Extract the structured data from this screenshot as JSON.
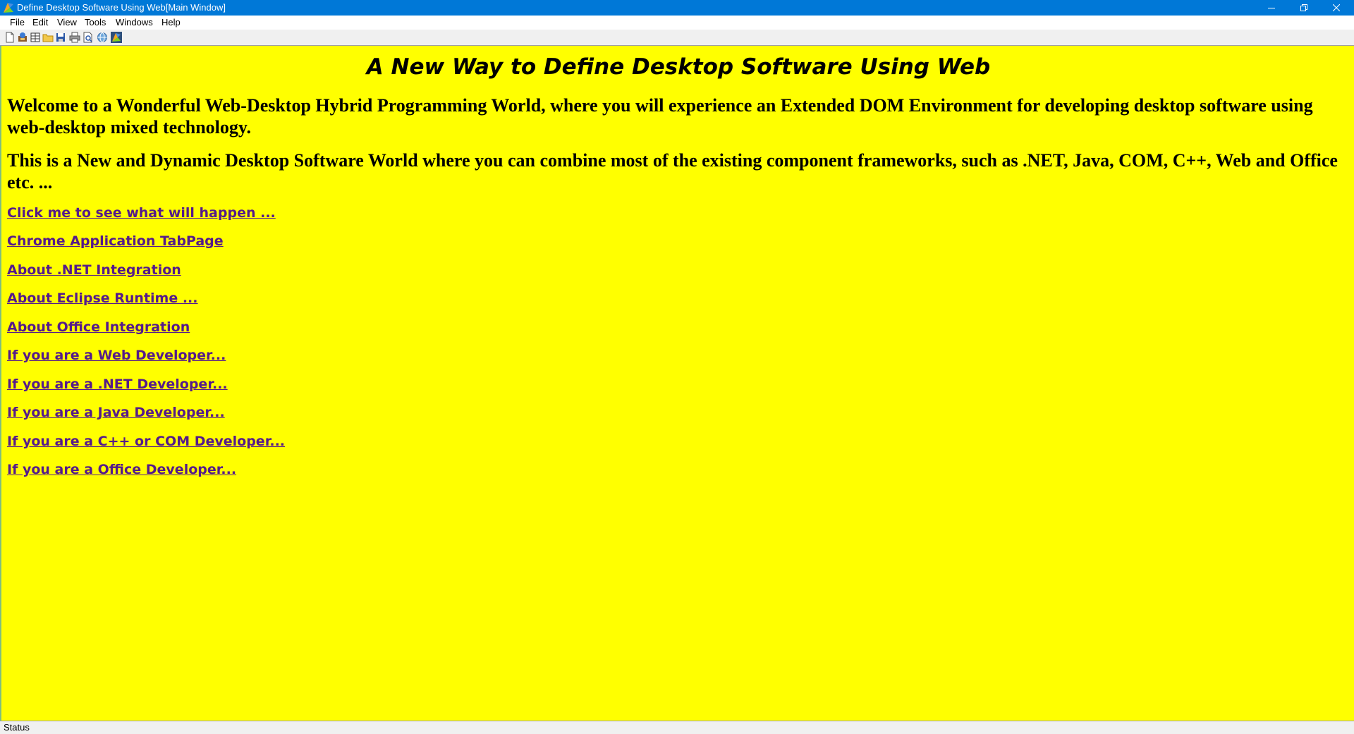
{
  "window": {
    "title": "Define Desktop Software Using Web[Main Window]",
    "app_icon": "app-logo-icon"
  },
  "menubar": {
    "items": [
      "File",
      "Edit",
      "View",
      "Tools",
      "Windows",
      "Help"
    ]
  },
  "toolbar": {
    "buttons": [
      "new-document-icon",
      "web-app-icon",
      "table-icon",
      "open-folder-icon",
      "save-icon",
      "print-icon",
      "print-preview-icon",
      "globe-icon",
      "app-logo-icon"
    ]
  },
  "content": {
    "heading": "A New Way to Define Desktop Software Using Web",
    "paragraphs": [
      "Welcome to a Wonderful Web-Desktop Hybrid Programming World, where you will experience an Extended DOM Environment for developing desktop software using web-desktop mixed technology.",
      "This is a New and Dynamic Desktop Software World where you can combine most of the existing component frameworks, such as .NET, Java, COM, C++, Web and Office etc. ..."
    ],
    "links": [
      "Click me to see what will happen ...",
      "Chrome Application TabPage",
      "About .NET Integration",
      "About Eclipse Runtime ...",
      "About Office Integration",
      "If you are a Web Developer...",
      "If you are a .NET Developer...",
      "If you are a Java Developer...",
      "If you are a C++ or COM Developer...",
      "If you are a Office Developer..."
    ],
    "background_color": "#ffff00",
    "link_color": "#551a8b"
  },
  "statusbar": {
    "text": "Status"
  },
  "colors": {
    "titlebar": "#0078d7"
  }
}
